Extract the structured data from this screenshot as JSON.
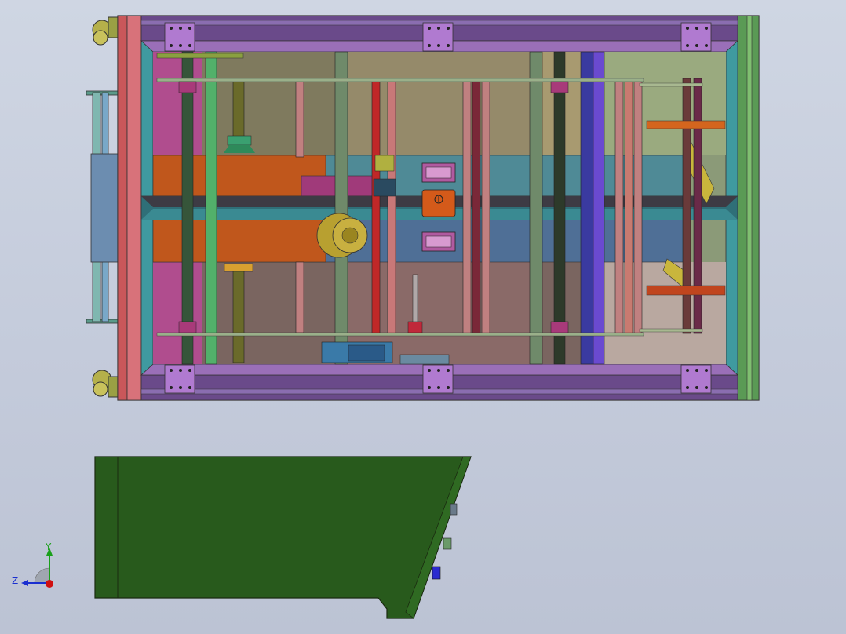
{
  "viewport": {
    "background_top": "#cfd6e3",
    "background_bottom": "#bcc3d4"
  },
  "views": {
    "top_view": "machine-frame-top-view",
    "side_view": "enclosure-side-view"
  },
  "colors": {
    "frame_outline": "#3a3030",
    "side_view_fill": "#285a1c",
    "axis_y": "#1aa01a",
    "axis_z": "#1a2fd0",
    "axis_origin": "#d01010"
  },
  "triad": {
    "y_label": "Y",
    "z_label": "Z"
  }
}
